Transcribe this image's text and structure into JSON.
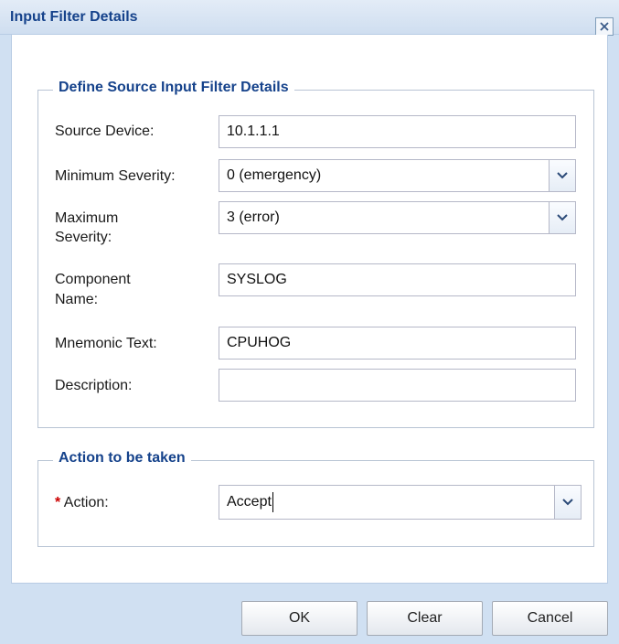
{
  "dialog": {
    "title": "Input Filter Details",
    "close_icon": "close-icon"
  },
  "source_section": {
    "legend": "Define Source Input Filter Details",
    "source_device": {
      "label": "Source Device:",
      "value": "10.1.1.1"
    },
    "min_severity": {
      "label": "Minimum Severity:",
      "value": "0 (emergency)"
    },
    "max_severity": {
      "label_line1": "Maximum",
      "label_line2": "Severity:",
      "value": "3 (error)"
    },
    "component_name": {
      "label_line1": "Component",
      "label_line2": "Name:",
      "value": "SYSLOG"
    },
    "mnemonic_text": {
      "label": "Mnemonic Text:",
      "value": "CPUHOG"
    },
    "description": {
      "label": "Description:",
      "value": ""
    }
  },
  "action_section": {
    "legend": "Action to be taken",
    "action": {
      "required_marker": "*",
      "label": "Action:",
      "value": "Accept"
    }
  },
  "buttons": {
    "ok": "OK",
    "clear": "Clear",
    "cancel": "Cancel"
  },
  "colors": {
    "title_text": "#15428b",
    "dialog_frame": "#d0e0f2",
    "required": "#cc0000"
  }
}
